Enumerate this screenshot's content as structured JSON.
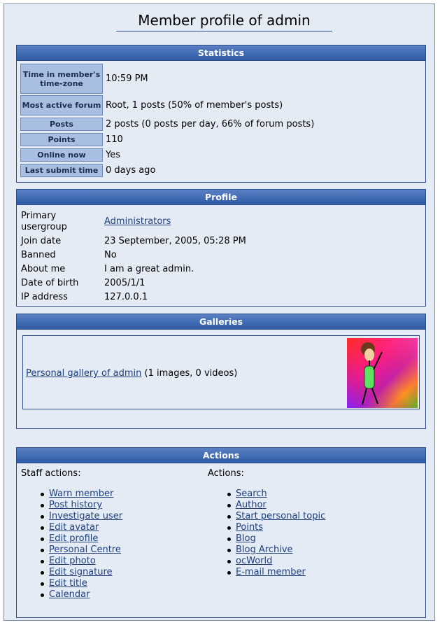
{
  "page_title": "Member profile of admin",
  "statistics": {
    "heading": "Statistics",
    "rows": [
      {
        "label": "Time in member's time-zone",
        "value": "10:59 PM"
      },
      {
        "label": "Most active forum",
        "value": "Root, 1 posts (50% of member's posts)"
      },
      {
        "label": "Posts",
        "value": "2 posts (0 posts per day, 66% of forum posts)"
      },
      {
        "label": "Points",
        "value": "110"
      },
      {
        "label": "Online now",
        "value": "Yes"
      },
      {
        "label": "Last submit time",
        "value": "0 days ago"
      }
    ]
  },
  "profile": {
    "heading": "Profile",
    "rows": [
      {
        "label": "Primary usergroup",
        "value": "Administrators"
      },
      {
        "label": "Join date",
        "value": "23 September, 2005, 05:28 PM"
      },
      {
        "label": "Banned",
        "value": "No"
      },
      {
        "label": "About me",
        "value": "I am a great admin."
      },
      {
        "label": "Date of birth",
        "value": "2005/1/1"
      },
      {
        "label": "IP address",
        "value": "127.0.0.1"
      }
    ]
  },
  "galleries": {
    "heading": "Galleries",
    "link": "Personal gallery of admin",
    "count_text": "(1 images, 0 videos)"
  },
  "actions": {
    "heading": "Actions",
    "staff_title": "Staff actions:",
    "staff_items": [
      "Warn member",
      "Post history",
      "Investigate user",
      "Edit avatar",
      "Edit profile",
      "Personal Centre",
      "Edit photo",
      "Edit signature",
      "Edit title",
      "Calendar"
    ],
    "actions_title": "Actions:",
    "action_items": [
      "Search",
      "Author",
      "Start personal topic",
      "Points",
      "Blog",
      "Blog Archive",
      "ocWorld",
      "E-mail member"
    ]
  },
  "colors": {
    "header_bar": "#2f5ca6",
    "panel_bg": "#e4ebf5",
    "label_bg": "#a9bfe2",
    "link": "#1d3f80"
  }
}
